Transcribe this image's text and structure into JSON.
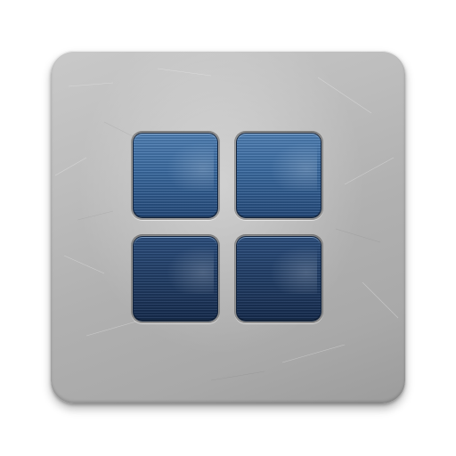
{
  "icon": {
    "name": "tile-grid-app-icon",
    "plate_color": "#b8b8b8",
    "tile_color_light": "#3a6aa0",
    "tile_color_dark": "#223f68",
    "tiles": [
      {
        "id": "top-left",
        "shade": "light"
      },
      {
        "id": "top-right",
        "shade": "light"
      },
      {
        "id": "bottom-left",
        "shade": "dark"
      },
      {
        "id": "bottom-right",
        "shade": "dark"
      }
    ]
  }
}
